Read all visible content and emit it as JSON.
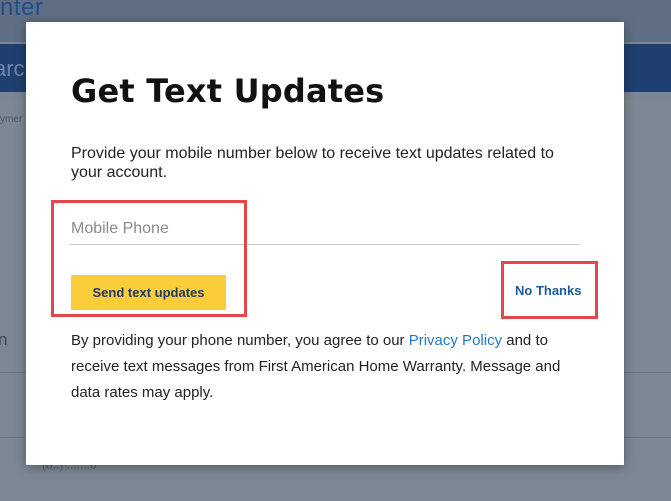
{
  "background": {
    "header_title_fragment": "nter",
    "band_text_fragment": "arc",
    "breadcrumb_fragment": "ymer",
    "side_letter": "n",
    "phone_fragment": "(8..) .......0"
  },
  "modal": {
    "title": "Get Text Updates",
    "description": "Provide your mobile number below to receive text updates related to your account.",
    "phone_input": {
      "placeholder": "Mobile Phone",
      "value": ""
    },
    "send_button_label": "Send text updates",
    "no_thanks_label": "No Thanks",
    "consent": {
      "prefix": "By providing your phone number, you agree to our ",
      "link_text": "Privacy Policy",
      "suffix": " and to receive text messages from First American Home Warranty. Message and data rates may apply."
    }
  },
  "colors": {
    "overlay": "#7b8593",
    "button_yellow": "#fccd3a",
    "button_text": "#1d3a66",
    "link_blue": "#1e7ac4",
    "highlight_red": "#e2474b"
  }
}
